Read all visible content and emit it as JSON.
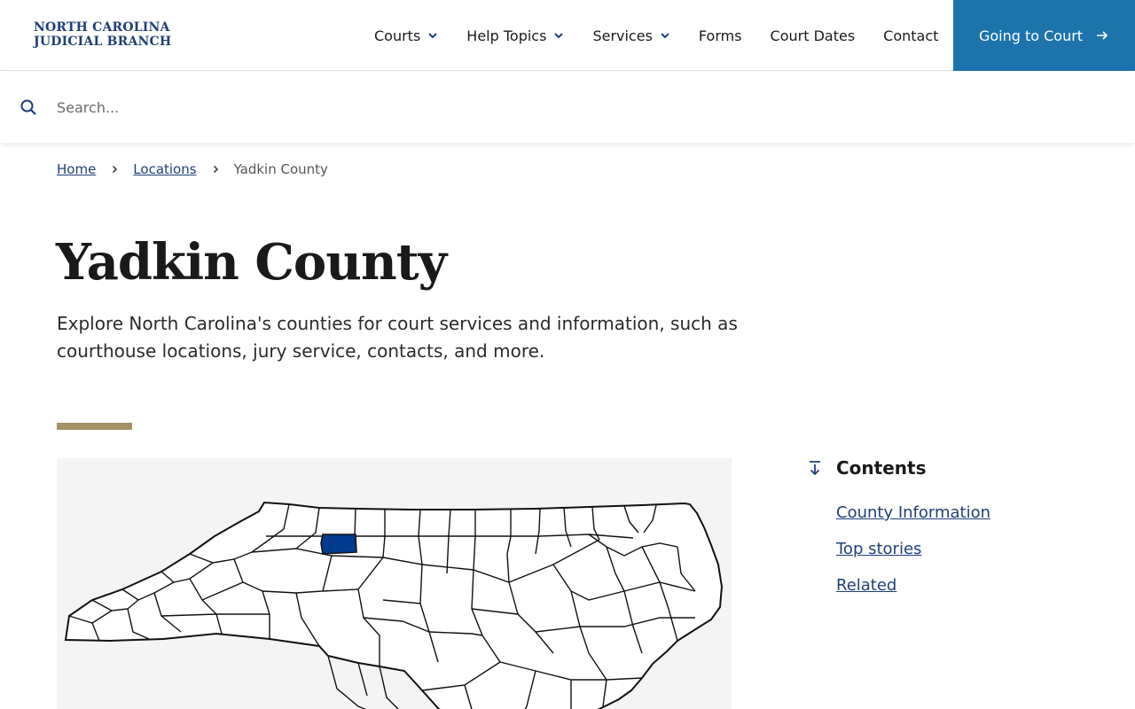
{
  "brand": {
    "line1": "NORTH CAROLINA",
    "line2": "JUDICIAL BRANCH",
    "color": "#1f3f7a"
  },
  "nav": {
    "items": [
      {
        "label": "Courts",
        "has_dropdown": true
      },
      {
        "label": "Help Topics",
        "has_dropdown": true
      },
      {
        "label": "Services",
        "has_dropdown": true
      },
      {
        "label": "Forms",
        "has_dropdown": false
      },
      {
        "label": "Court Dates",
        "has_dropdown": false
      },
      {
        "label": "Contact",
        "has_dropdown": false
      }
    ],
    "cta_label": "Going to Court",
    "cta_color": "#1d74ad"
  },
  "search": {
    "placeholder": "Search...",
    "value": ""
  },
  "breadcrumb": {
    "home": "Home",
    "locations": "Locations",
    "current": "Yadkin County"
  },
  "page": {
    "title": "Yadkin County",
    "intro": "Explore North Carolina's counties for court services and information, such as courthouse locations, jury service, contacts, and more.",
    "accent_color": "#a69068",
    "highlight_color": "#003b8e"
  },
  "contents": {
    "heading": "Contents",
    "items": [
      {
        "label": "County Information"
      },
      {
        "label": "Top stories"
      },
      {
        "label": "Related"
      }
    ]
  }
}
